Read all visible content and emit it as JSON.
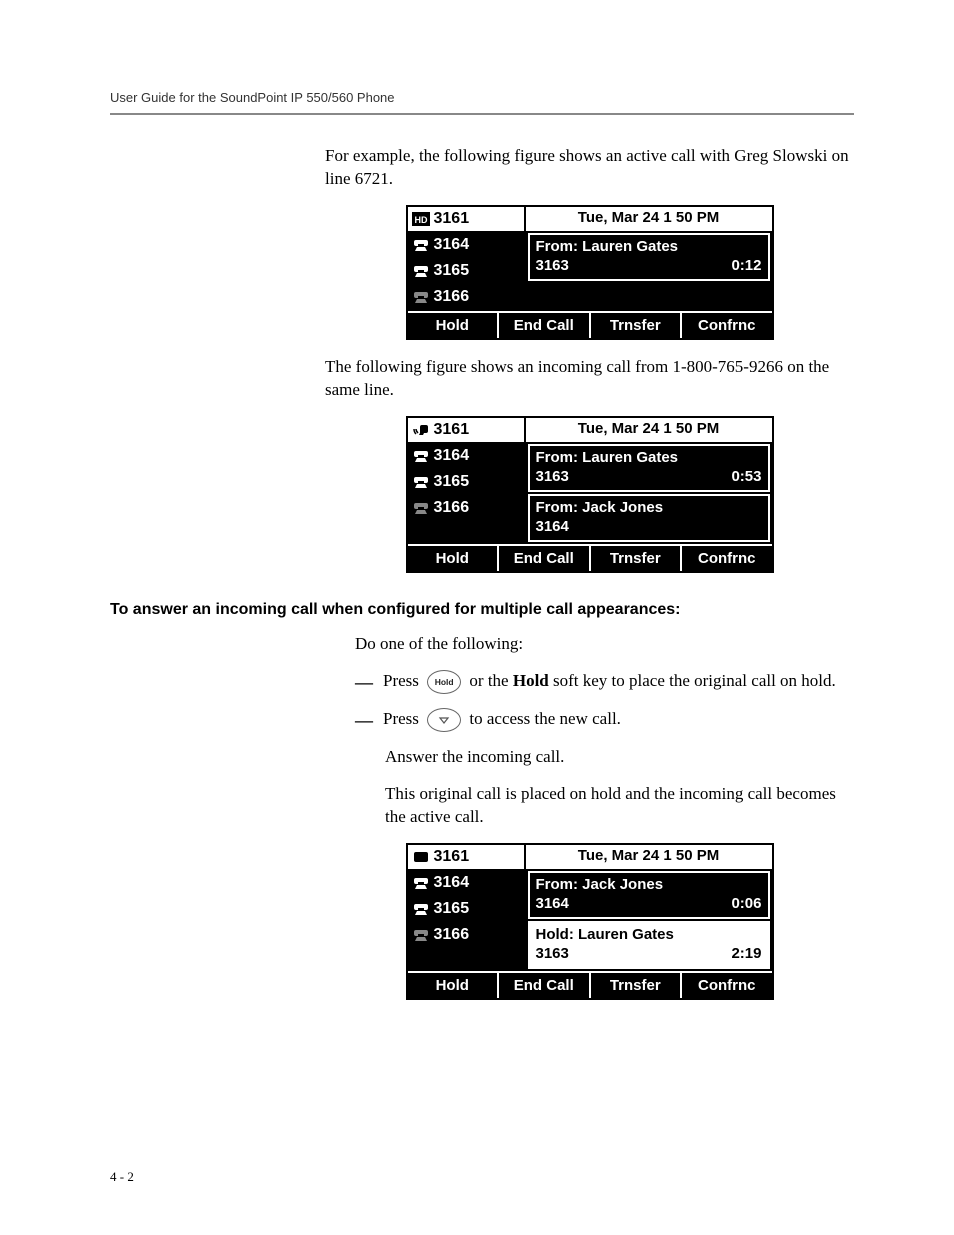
{
  "header": {
    "running_head": "User Guide for the SoundPoint IP 550/560 Phone"
  },
  "p1": "For example, the following figure shows an active call with Greg Slowski on line 6721.",
  "p2": "The following figure shows an incoming call from 1-800-765-9266 on the same line.",
  "heading": "To answer an incoming call when configured for multiple call appearances:",
  "p3": "Do one of the following:",
  "bullet1_a": "Press",
  "bullet1_hold_btn": "Hold",
  "bullet1_b": " or the ",
  "bullet1_bold": "Hold",
  "bullet1_c": " soft key to place the original call on hold.",
  "bullet2_a": "Press",
  "bullet2_b": " to access the new call.",
  "p4": "Answer the incoming call.",
  "p5": "This original call is placed on hold and the incoming call becomes the active call.",
  "pagenum": "4 - 2",
  "screens": {
    "common": {
      "date": "Tue, Mar 24  1 50 PM",
      "lines": {
        "l1": "3161",
        "l2": "3164",
        "l3": "3165",
        "l4": "3166"
      },
      "softkeys": {
        "hold": "Hold",
        "end": "End Call",
        "trns": "Trnsfer",
        "conf": "Confrnc"
      }
    },
    "s1": {
      "card1": {
        "from": "From: Lauren Gates",
        "num": "3163",
        "dur": "0:12"
      }
    },
    "s2": {
      "card1": {
        "from": "From: Lauren Gates",
        "num": "3163",
        "dur": "0:53"
      },
      "card2": {
        "from": "From: Jack Jones",
        "num": "3164"
      }
    },
    "s3": {
      "card1": {
        "from": "From: Jack Jones",
        "num": "3164",
        "dur": "0:06"
      },
      "card2": {
        "from": "Hold: Lauren Gates",
        "num": "3163",
        "dur": "2:19"
      }
    }
  }
}
